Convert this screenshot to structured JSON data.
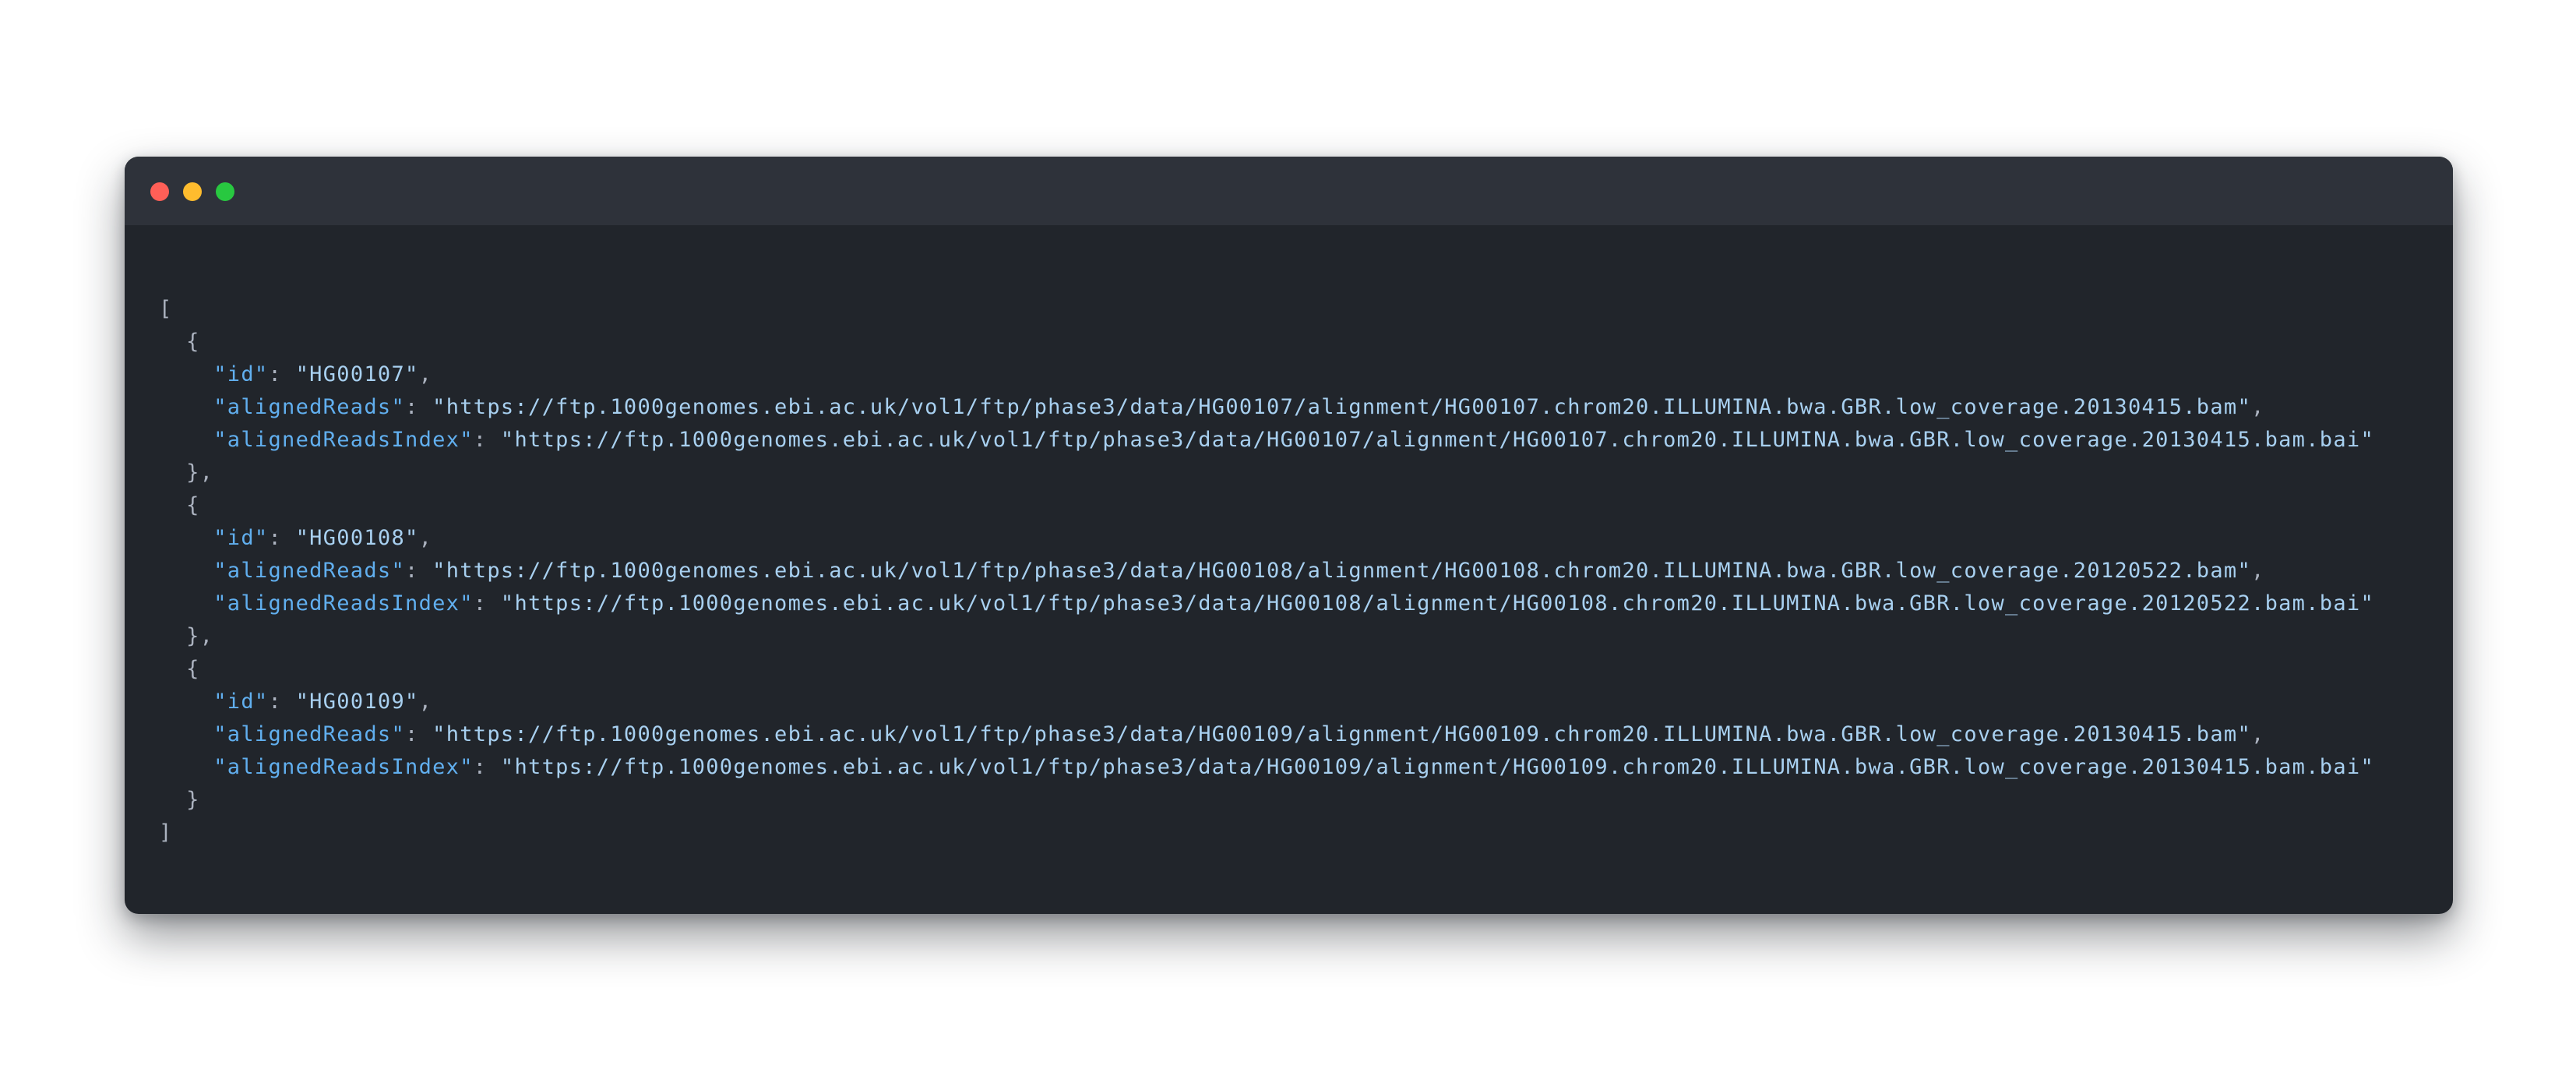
{
  "window": {
    "controls": [
      {
        "name": "close",
        "color": "#ff5f57"
      },
      {
        "name": "minimize",
        "color": "#febc2e"
      },
      {
        "name": "maximize",
        "color": "#28c840"
      }
    ]
  },
  "colors": {
    "background": "#21252b",
    "titlebar": "#2e323a",
    "key": "#61afef",
    "string": "#a8d0f0",
    "punctuation": "#abb2bf"
  },
  "code": {
    "open_bracket": "[",
    "close_bracket": "]",
    "records": [
      {
        "id": {
          "key": "\"id\"",
          "value": "\"HG00107\""
        },
        "alignedReads": {
          "key": "\"alignedReads\"",
          "value": "\"https://ftp.1000genomes.ebi.ac.uk/vol1/ftp/phase3/data/HG00107/alignment/HG00107.chrom20.ILLUMINA.bwa.GBR.low_coverage.20130415.bam\""
        },
        "alignedReadsIndex": {
          "key": "\"alignedReadsIndex\"",
          "value": "\"https://ftp.1000genomes.ebi.ac.uk/vol1/ftp/phase3/data/HG00107/alignment/HG00107.chrom20.ILLUMINA.bwa.GBR.low_coverage.20130415.bam.bai\""
        },
        "close": "},"
      },
      {
        "id": {
          "key": "\"id\"",
          "value": "\"HG00108\""
        },
        "alignedReads": {
          "key": "\"alignedReads\"",
          "value": "\"https://ftp.1000genomes.ebi.ac.uk/vol1/ftp/phase3/data/HG00108/alignment/HG00108.chrom20.ILLUMINA.bwa.GBR.low_coverage.20120522.bam\""
        },
        "alignedReadsIndex": {
          "key": "\"alignedReadsIndex\"",
          "value": "\"https://ftp.1000genomes.ebi.ac.uk/vol1/ftp/phase3/data/HG00108/alignment/HG00108.chrom20.ILLUMINA.bwa.GBR.low_coverage.20120522.bam.bai\""
        },
        "close": "},"
      },
      {
        "id": {
          "key": "\"id\"",
          "value": "\"HG00109\""
        },
        "alignedReads": {
          "key": "\"alignedReads\"",
          "value": "\"https://ftp.1000genomes.ebi.ac.uk/vol1/ftp/phase3/data/HG00109/alignment/HG00109.chrom20.ILLUMINA.bwa.GBR.low_coverage.20130415.bam\""
        },
        "alignedReadsIndex": {
          "key": "\"alignedReadsIndex\"",
          "value": "\"https://ftp.1000genomes.ebi.ac.uk/vol1/ftp/phase3/data/HG00109/alignment/HG00109.chrom20.ILLUMINA.bwa.GBR.low_coverage.20130415.bam.bai\""
        },
        "close": "}"
      }
    ]
  }
}
